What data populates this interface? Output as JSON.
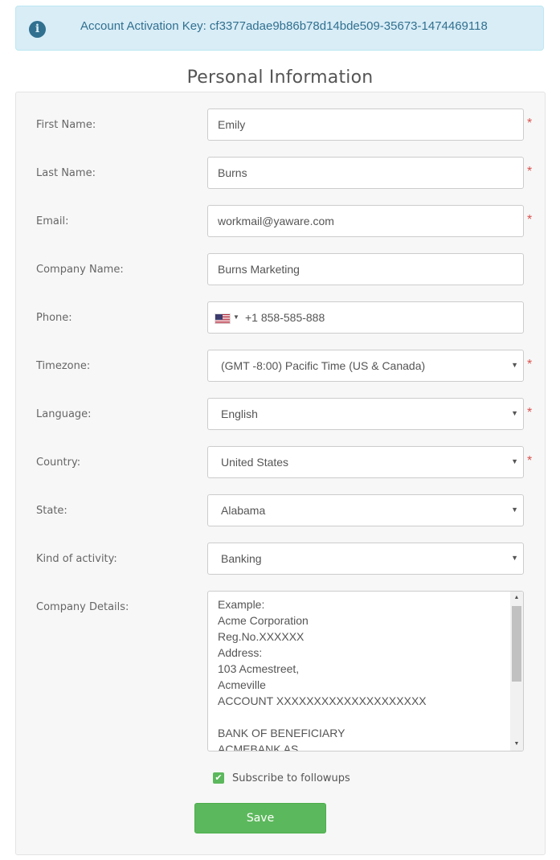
{
  "alert": {
    "icon": "info-circle-icon",
    "text": "Account Activation Key: cf3377adae9b86b78d14bde509-35673-1474469118"
  },
  "section_title": "Personal Information",
  "required_mark": "*",
  "fields": {
    "first_name": {
      "label": "First Name:",
      "value": "Emily"
    },
    "last_name": {
      "label": "Last Name:",
      "value": "Burns"
    },
    "email": {
      "label": "Email:",
      "value": "workmail@yaware.com"
    },
    "company_name": {
      "label": "Company Name:",
      "value": "Burns Marketing"
    },
    "phone": {
      "label": "Phone:",
      "value": "+1 858-585-888",
      "flag_icon": "us-flag-icon"
    },
    "timezone": {
      "label": "Timezone:",
      "value": "(GMT -8:00) Pacific Time (US & Canada)"
    },
    "language": {
      "label": "Language:",
      "value": "English"
    },
    "country": {
      "label": "Country:",
      "value": "United States"
    },
    "state": {
      "label": "State:",
      "value": "Alabama"
    },
    "activity": {
      "label": "Kind of activity:",
      "value": "Banking"
    },
    "company_details": {
      "label": "Company Details:",
      "lines": [
        "Example:",
        "Acme Corporation",
        "Reg.No.XXXXXX",
        "Address:",
        "103 Acmestreet,",
        "Acmeville",
        "ACCOUNT XXXXXXXXXXXXXXXXXXXX",
        "",
        "BANK OF BENEFICIARY",
        "ACMEBANK AS"
      ]
    }
  },
  "subscribe": {
    "label": "Subscribe to followups",
    "checked": true
  },
  "save_label": "Save",
  "colors": {
    "alert_bg": "#d9edf7",
    "alert_text": "#31708f",
    "required": "#d9534f",
    "success": "#5cb85c"
  }
}
